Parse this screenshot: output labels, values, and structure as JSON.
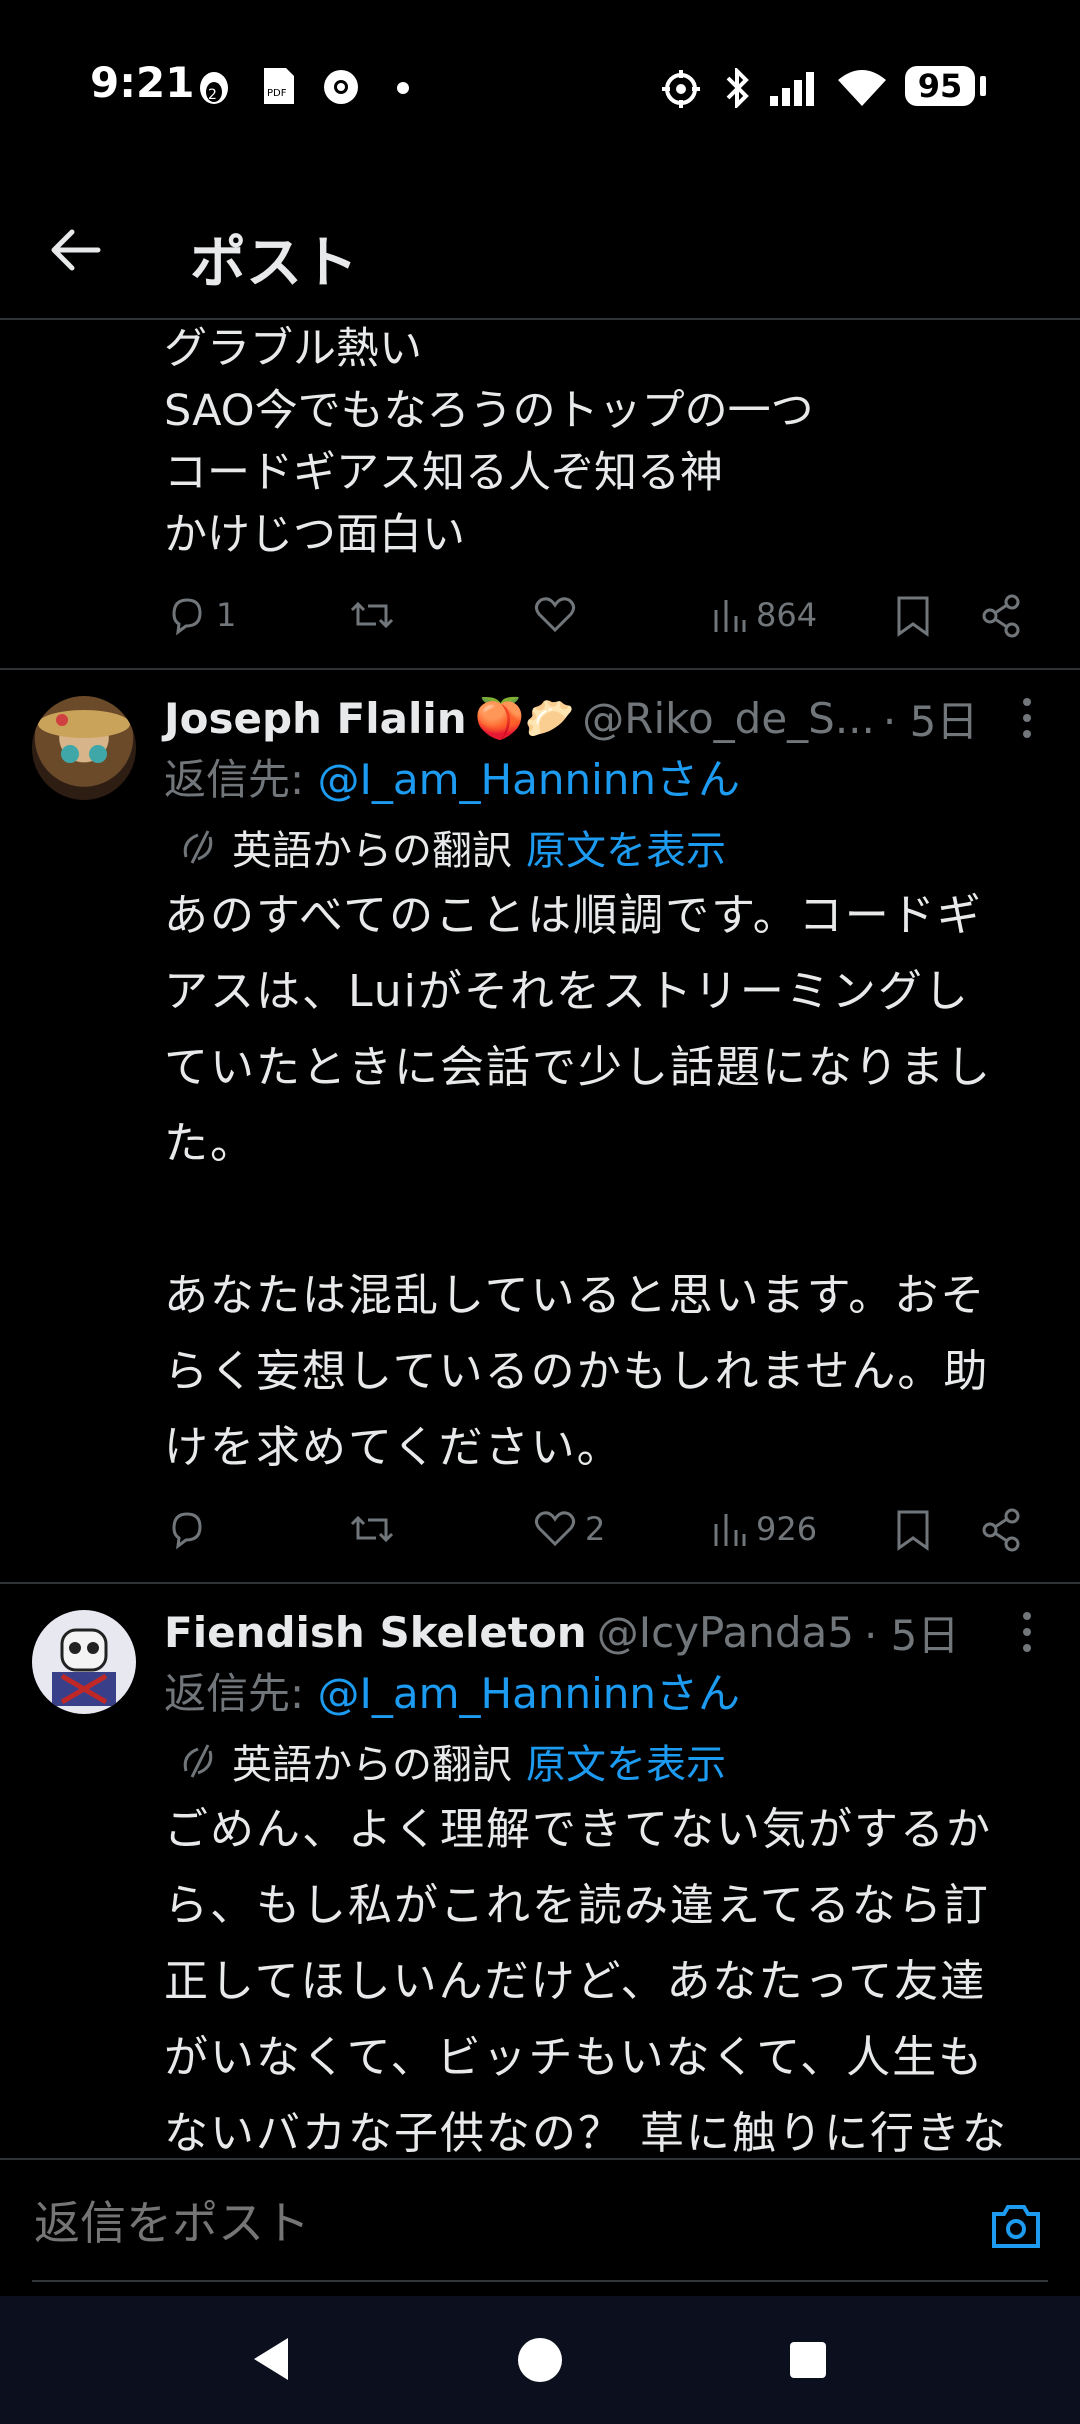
{
  "status_bar": {
    "time": "9:21",
    "battery": "95",
    "notif_icons": [
      "penguin-icon",
      "pdf-icon",
      "chrome-icon",
      "dot-icon"
    ],
    "right_icons": [
      "location-icon",
      "bluetooth-icon",
      "signal-icon",
      "wifi-icon",
      "battery-icon"
    ]
  },
  "header": {
    "title": "ポスト"
  },
  "colors": {
    "accent": "#1d9bf0",
    "muted": "#71767b",
    "text": "#e7e9ea",
    "divider": "#2f3336"
  },
  "tweets": [
    {
      "text_lines": [
        "グラブル熱い",
        "SAO今でもなろうのトップの一つ",
        "コードギアス知る人ぞ知る神",
        "かけじつ面白い"
      ],
      "actions": {
        "reply_count": "1",
        "retweet_count": "",
        "like_count": "",
        "views": "864"
      }
    },
    {
      "name": "Joseph Flalin",
      "emoji": "🍑🥟",
      "handle": "@Riko_de_S...",
      "time": "· 5日",
      "reply_prefix": "返信先: ",
      "reply_mention": "@I_am_Hanninnさん",
      "translation_label": "英語からの翻訳",
      "show_original": "原文を表示",
      "body_lines": [
        "あのすべてのことは順調です。コードギ",
        "アスは、Luiがそれをストリーミングし",
        "ていたときに会話で少し話題になりまし",
        "た。",
        "",
        "あなたは混乱していると思います。おそ",
        "らく妄想しているのかもしれません。助",
        "けを求めてください。"
      ],
      "actions": {
        "reply_count": "",
        "retweet_count": "",
        "like_count": "2",
        "views": "926"
      }
    },
    {
      "name": "Fiendish Skeleton",
      "handle": "@IcyPanda5",
      "time": "· 5日",
      "reply_prefix": "返信先: ",
      "reply_mention": "@I_am_Hanninnさん",
      "translation_label": "英語からの翻訳",
      "show_original": "原文を表示",
      "body_lines": [
        "ごめん、よく理解できてない気がするか",
        "ら、もし私がこれを読み違えてるなら訂",
        "正してほしいんだけど、あなたって友達",
        "がいなくて、ビッチもいなくて、人生も",
        "ないバカな子供なの？ 草に触りに行きな"
      ]
    }
  ],
  "composer": {
    "placeholder": "返信をポスト"
  }
}
